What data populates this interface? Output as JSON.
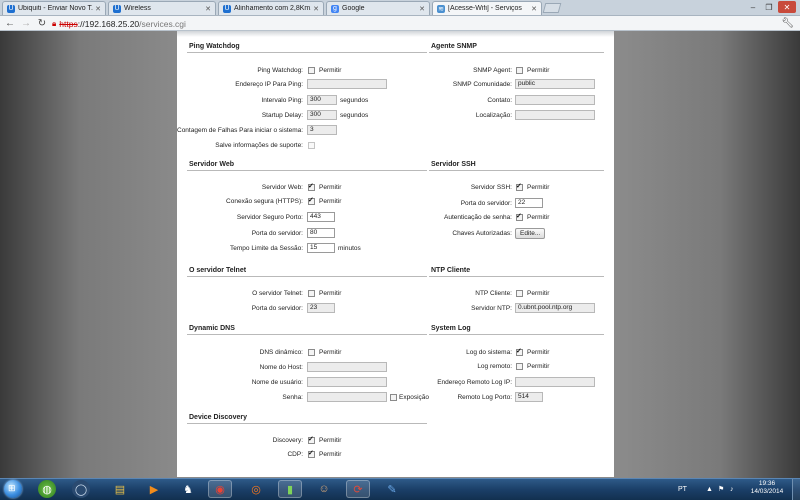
{
  "browser": {
    "tabs": [
      {
        "label": "Ubiquiti - Enviar Novo T...",
        "icon_color": "#1e6fd0"
      },
      {
        "label": "Wireless",
        "icon_color": "#1e6fd0"
      },
      {
        "label": "Alinhamento com 2,8Km...",
        "icon_color": "#1e6fd0"
      },
      {
        "label": "Google",
        "icon_color": "#4285f4"
      },
      {
        "label": "[Acesse-Wifi] - Serviços",
        "icon_color": "#4a90d0"
      }
    ],
    "url": {
      "protocol": "https",
      "host": "://192.168.25.20",
      "path": "/services.cgi"
    }
  },
  "sections": {
    "ping": {
      "title": "Ping Watchdog",
      "watchdog_label": "Ping Watchdog:",
      "watchdog_chk": "Permitir",
      "ip_label": "Endereço IP Para Ping:",
      "ip_value": "",
      "interval_label": "Intervalo Ping:",
      "interval_value": "300",
      "interval_unit": "segundos",
      "startup_label": "Startup Delay:",
      "startup_value": "300",
      "startup_unit": "segundos",
      "failcount_label": "Contagem de Falhas Para iniciar o sistema:",
      "failcount_value": "3",
      "support_label": "Salve informações de suporte:"
    },
    "snmp": {
      "title": "Agente SNMP",
      "agent_label": "SNMP Agent:",
      "agent_chk": "Permitir",
      "community_label": "SNMP Comunidade:",
      "community_value": "public",
      "contact_label": "Contato:",
      "contact_value": "",
      "location_label": "Localização:",
      "location_value": ""
    },
    "web": {
      "title": "Servidor Web",
      "server_label": "Servidor Web:",
      "server_chk": "Permitir",
      "secure_label": "Conexão segura (HTTPS):",
      "secure_chk": "Permitir",
      "secure_port_label": "Servidor Seguro Porto:",
      "secure_port_value": "443",
      "port_label": "Porta do servidor:",
      "port_value": "80",
      "timeout_label": "Tempo Limite da Sessão:",
      "timeout_value": "15",
      "timeout_unit": "minutos"
    },
    "ssh": {
      "title": "Servidor SSH",
      "server_label": "Servidor SSH:",
      "server_chk": "Permitir",
      "port_label": "Porta do servidor:",
      "port_value": "22",
      "auth_label": "Autenticação de senha:",
      "auth_chk": "Permitir",
      "keys_label": "Chaves Autorizadas:",
      "keys_button": "Edite..."
    },
    "telnet": {
      "title": "O servidor Telnet",
      "server_label": "O servidor Telnet:",
      "server_chk": "Permitir",
      "port_label": "Porta do servidor:",
      "port_value": "23"
    },
    "ntp": {
      "title": "NTP Cliente",
      "client_label": "NTP Cliente:",
      "client_chk": "Permitir",
      "server_label": "Servidor NTP:",
      "server_value": "0.ubnt.pool.ntp.org"
    },
    "ddns": {
      "title": "Dynamic DNS",
      "dyn_label": "DNS dinâmico:",
      "dyn_chk": "Permitir",
      "host_label": "Nome do Host:",
      "host_value": "",
      "user_label": "Nome de usuário:",
      "user_value": "",
      "pass_label": "Senha:",
      "pass_value": "",
      "show_chk": "Exposição"
    },
    "syslog": {
      "title": "System Log",
      "log_label": "Log do sistema:",
      "log_chk": "Permitir",
      "remote_label": "Log remoto:",
      "remote_chk": "Permitir",
      "remote_ip_label": "Endereço Remoto Log IP:",
      "remote_ip_value": "",
      "remote_port_label": "Remoto Log Porto:",
      "remote_port_value": "514"
    },
    "discovery": {
      "title": "Device Discovery",
      "disc_label": "Discovery:",
      "disc_chk": "Permitir",
      "cdp_label": "CDP:",
      "cdp_chk": "Permitir"
    }
  },
  "taskbar": {
    "lang": "PT",
    "time": "19:36",
    "date": "14/03/2014"
  }
}
